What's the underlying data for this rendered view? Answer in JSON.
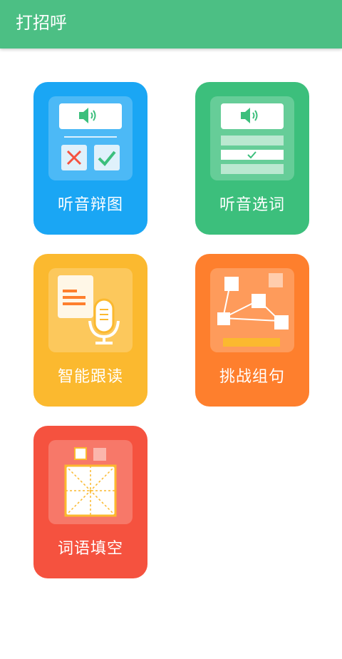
{
  "header": {
    "title": "打招呼"
  },
  "colors": {
    "header": "#4cbf84",
    "card1": "#1aa6f4",
    "card2": "#3cbf7c",
    "card3": "#fbb92f",
    "card4": "#fe7f2d",
    "card5": "#f5523f"
  },
  "cards": [
    {
      "label": "听音辩图",
      "icon": "listen-pick-image-icon"
    },
    {
      "label": "听音选词",
      "icon": "listen-pick-word-icon"
    },
    {
      "label": "智能跟读",
      "icon": "microphone-document-icon"
    },
    {
      "label": "挑战组句",
      "icon": "connect-nodes-icon"
    },
    {
      "label": "词语填空",
      "icon": "character-grid-icon"
    }
  ]
}
